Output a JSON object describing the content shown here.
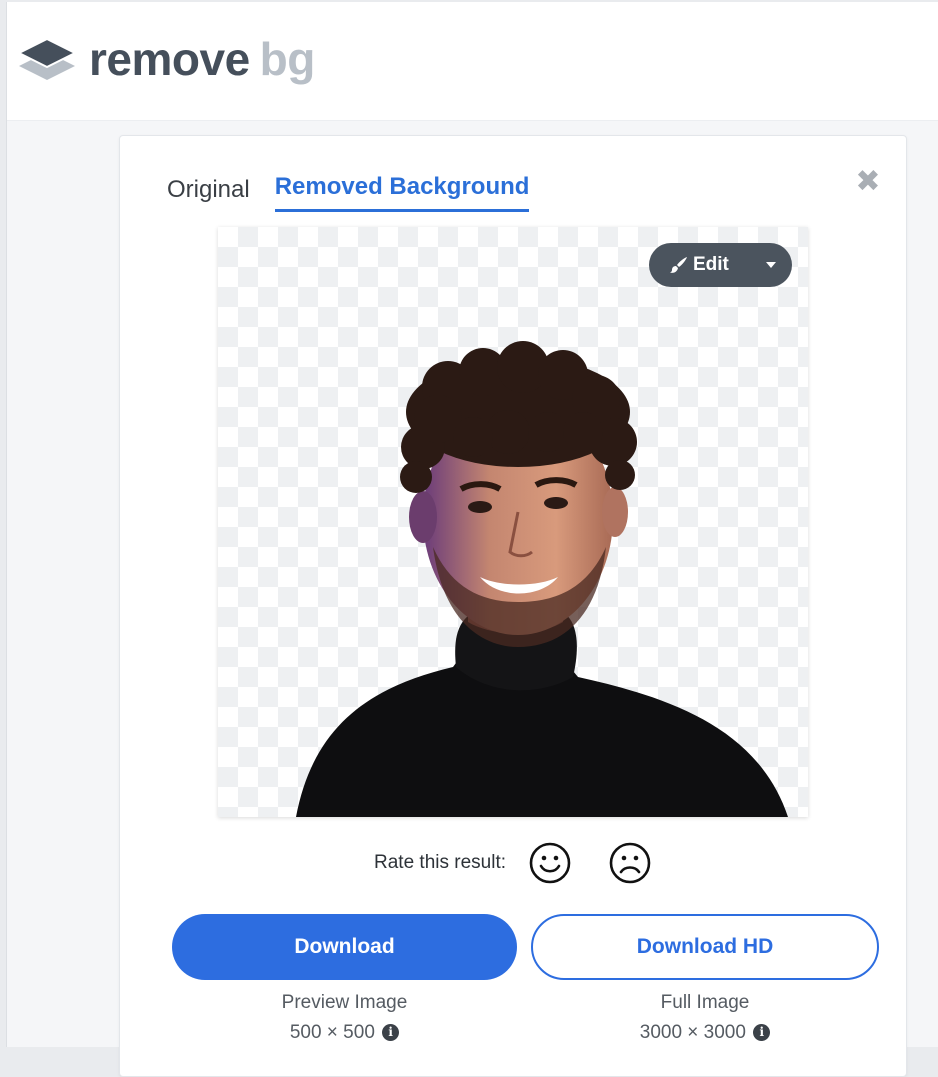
{
  "brand": {
    "word1": "remove",
    "word2": "bg"
  },
  "tabs": [
    {
      "label": "Original"
    },
    {
      "label": "Removed Background"
    }
  ],
  "close_label": "✖",
  "edit": {
    "label": "Edit"
  },
  "rating": {
    "label": "Rate this result:"
  },
  "downloads": {
    "standard": {
      "label": "Download",
      "caption": "Preview Image",
      "size": "500 × 500"
    },
    "hd": {
      "label": "Download HD",
      "caption": "Full Image",
      "size": "3000 × 3000"
    }
  },
  "info_glyph": "i",
  "colors": {
    "accent": "#2d6de0",
    "logo_dark": "#454f5b",
    "logo_light": "#b8bfc7"
  }
}
